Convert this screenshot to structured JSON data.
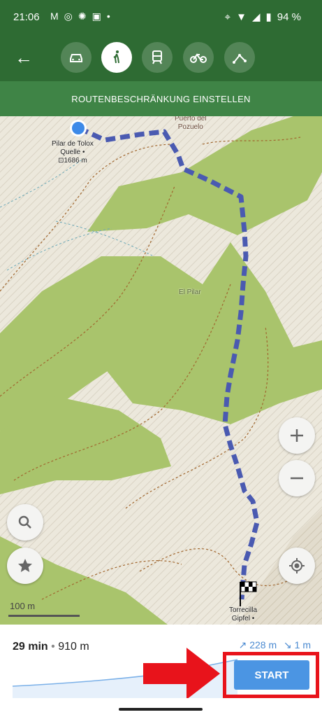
{
  "status": {
    "time": "21:06",
    "battery": "94 %"
  },
  "toolbar": {
    "modes": [
      "car-icon",
      "walk-icon",
      "train-icon",
      "bike-icon",
      "route-icon"
    ]
  },
  "restriction": {
    "label": "ROUTENBESCHRÄNKUNG EINSTELLEN"
  },
  "map": {
    "poi_start": {
      "name": "Pilar de Tolox",
      "line2": "Quelle •",
      "line3": "⊡1686 m"
    },
    "poi_pass": {
      "line1": "Puerto del",
      "line2": "Pozuelo"
    },
    "poi_area": "El Pilar",
    "poi_end": {
      "line1": "Torrecilla",
      "line2": "Gipfel •"
    },
    "scale": "100 m"
  },
  "summary": {
    "duration": "29 min",
    "distance": "910 m",
    "ascent": "↗ 228 m",
    "descent": "↘ 1 m"
  },
  "start_button": {
    "label": "START"
  },
  "colors": {
    "accent": "#2e6b33",
    "route": "#4a5ab1",
    "highlight": "#e8131b"
  }
}
